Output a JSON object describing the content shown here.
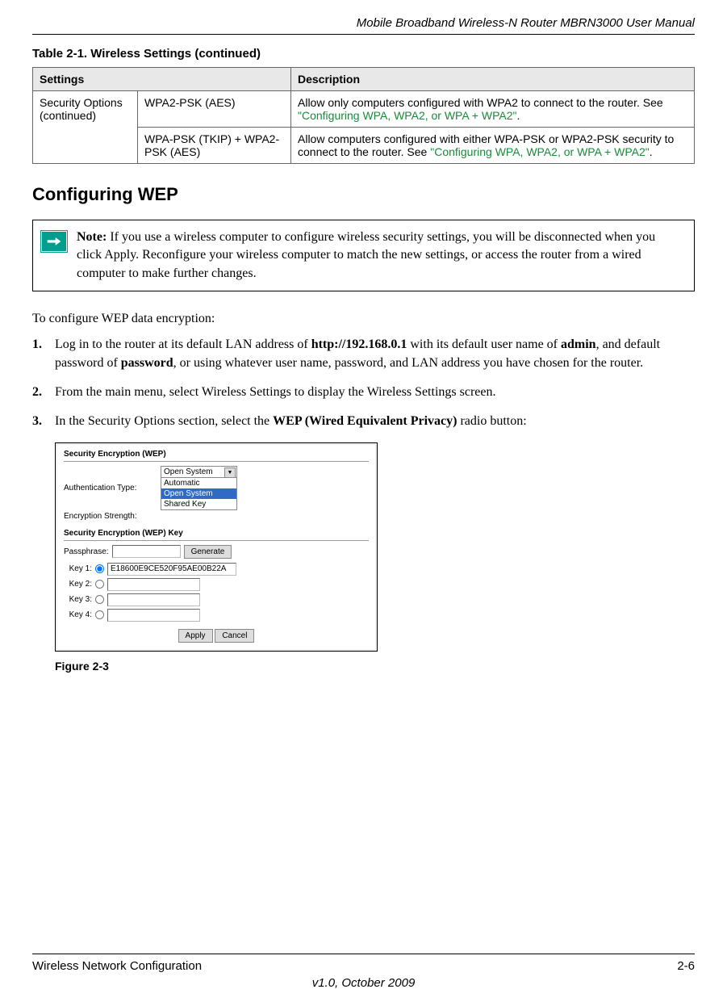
{
  "header": {
    "title": "Mobile Broadband Wireless-N Router MBRN3000 User Manual"
  },
  "table": {
    "caption": "Table 2-1.  Wireless Settings (continued)",
    "headers": {
      "col1": "Settings",
      "col2": "Description"
    },
    "rows": [
      {
        "c1": "Security Options (continued)",
        "c2": "WPA2-PSK (AES)",
        "c3_prefix": "Allow only computers configured with WPA2 to connect to the router. See ",
        "c3_link": "\"Configuring WPA, WPA2, or WPA + WPA2\"",
        "c3_suffix": "."
      },
      {
        "c2": "WPA-PSK (TKIP) + WPA2-PSK (AES)",
        "c3_prefix": "Allow computers configured with either WPA-PSK or WPA2-PSK security to connect to the router. See ",
        "c3_link": "\"Configuring WPA, WPA2, or WPA + WPA2\"",
        "c3_suffix": "."
      }
    ]
  },
  "section_heading": "Configuring WEP",
  "note": {
    "label": "Note:",
    "text": " If you use a wireless computer to configure wireless security settings, you will be disconnected when you click Apply. Reconfigure your wireless computer to match the new settings, or access the router from a wired computer to make further changes."
  },
  "intro": "To configure WEP data encryption:",
  "steps": {
    "s1_a": "Log in to the router at its default LAN address of ",
    "s1_b": "http://192.168.0.1",
    "s1_c": " with its default user name of ",
    "s1_d": "admin",
    "s1_e": ", and default password of ",
    "s1_f": "password",
    "s1_g": ", or using whatever user name, password, and LAN address you have chosen for the router.",
    "s2": "From the main menu, select Wireless Settings to display the Wireless Settings screen.",
    "s3_a": "In the Security Options section, select the ",
    "s3_b": "WEP (Wired Equivalent Privacy)",
    "s3_c": " radio button:"
  },
  "figure": {
    "group1_title": "Security Encryption (WEP)",
    "auth_label": "Authentication Type:",
    "enc_label": "Encryption Strength:",
    "dropdown": {
      "selected": "Open System",
      "opt1": "Automatic",
      "opt2": "Open System",
      "opt3": "Shared Key"
    },
    "group2_title": "Security Encryption (WEP) Key",
    "passphrase_label": "Passphrase:",
    "generate_btn": "Generate",
    "key1_label": "Key 1:",
    "key1_value": "E18600E9CE520F95AE00B22A",
    "key2_label": "Key 2:",
    "key3_label": "Key 3:",
    "key4_label": "Key 4:",
    "apply_btn": "Apply",
    "cancel_btn": "Cancel",
    "caption": "Figure 2-3"
  },
  "footer": {
    "left": "Wireless Network Configuration",
    "right": "2-6",
    "version": "v1.0, October 2009"
  }
}
